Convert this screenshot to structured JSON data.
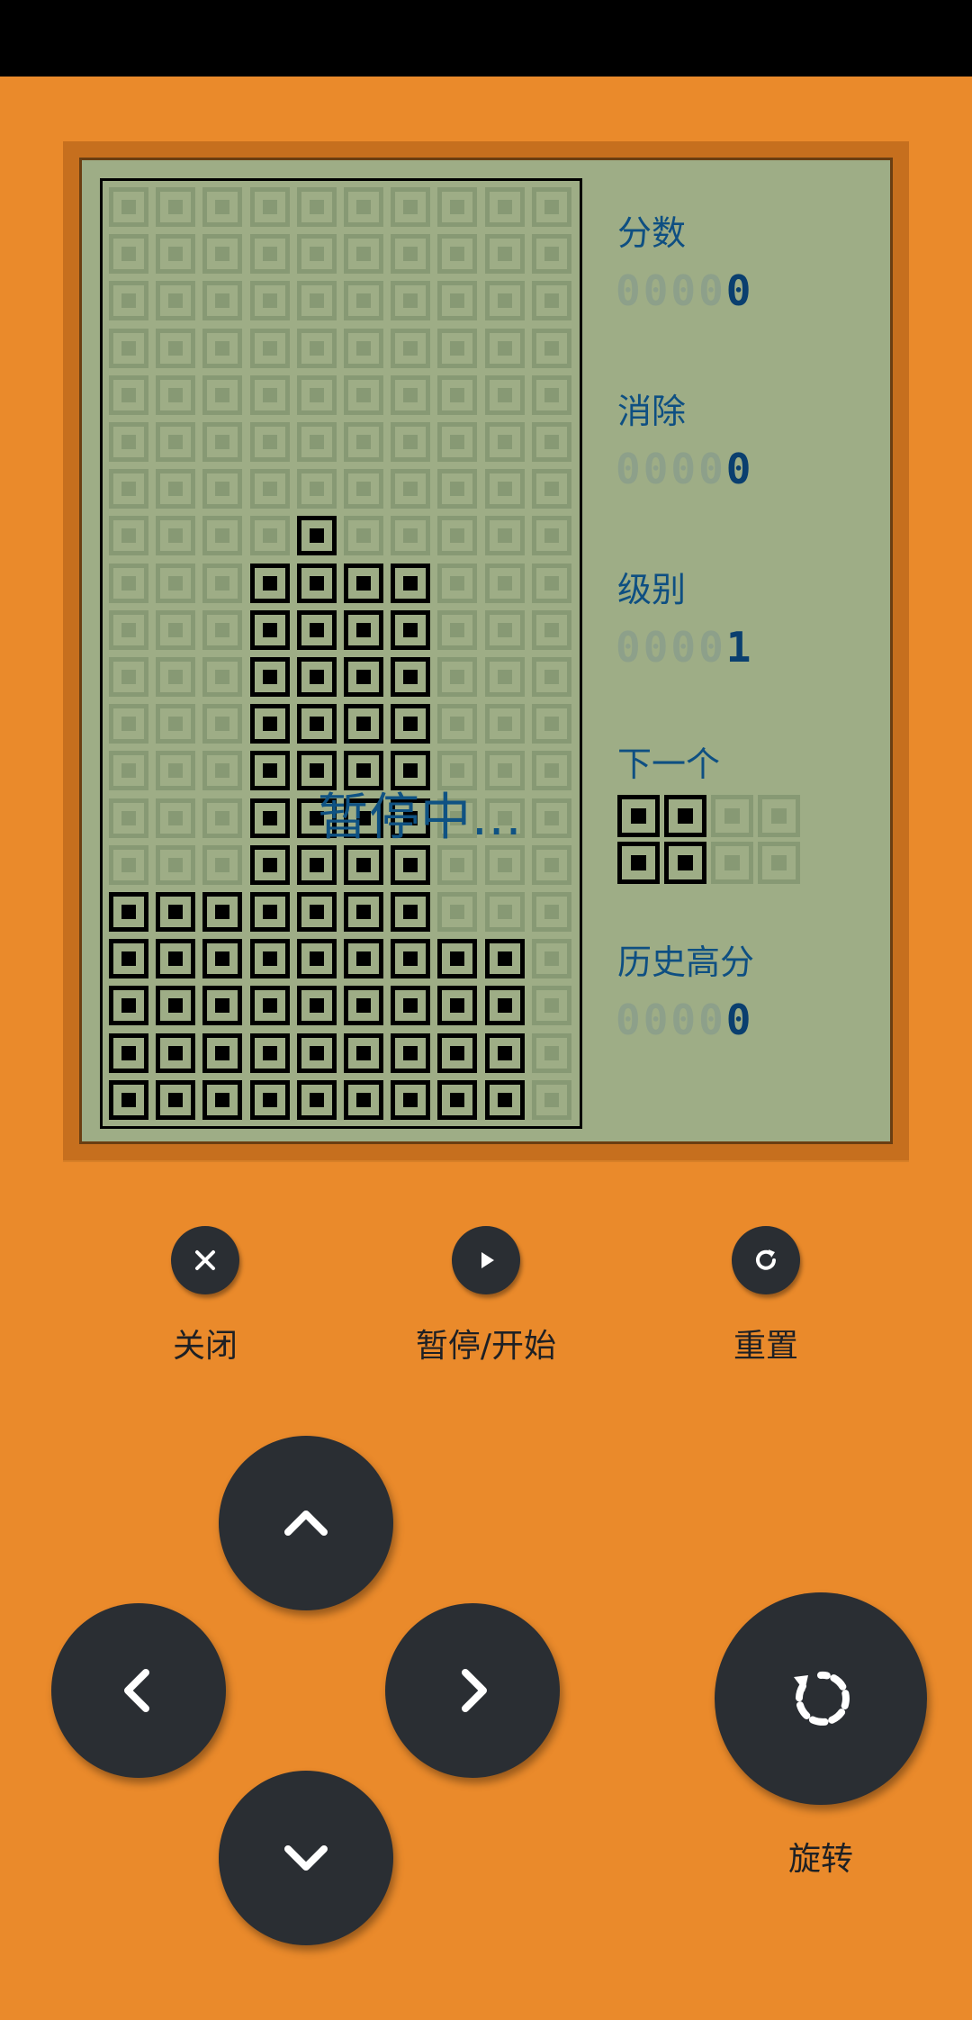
{
  "paused_text": "暂停中...",
  "score": {
    "label": "分数",
    "ghost": "0000",
    "value": "0"
  },
  "lines": {
    "label": "消除",
    "ghost": "0000",
    "value": "0"
  },
  "level": {
    "label": "级别",
    "ghost": "0000",
    "value": "1"
  },
  "next": {
    "label": "下一个",
    "piece": [
      [
        1,
        1,
        0,
        0
      ],
      [
        1,
        1,
        0,
        0
      ]
    ]
  },
  "high_score": {
    "label": "历史高分",
    "ghost": "0000",
    "value": "0"
  },
  "buttons": {
    "close": "关闭",
    "pause_start": "暂停/开始",
    "reset": "重置",
    "rotate": "旋转"
  },
  "icons": {
    "close": "close-icon",
    "pause_start": "play-icon",
    "reset": "refresh-icon",
    "up": "chevron-up-icon",
    "left": "chevron-left-icon",
    "right": "chevron-right-icon",
    "down": "chevron-down-icon",
    "rotate": "rotate-icon"
  },
  "colors": {
    "background": "#EA8A2B",
    "lcd": "#9EAD86",
    "block_on": "#000000",
    "block_off": "#879974",
    "text": "#0E4F82"
  },
  "board": {
    "cols": 10,
    "rows": 20,
    "grid": [
      "0000000000",
      "0000000000",
      "0000000000",
      "0000000000",
      "0000000000",
      "0000000000",
      "0000000000",
      "0000100000",
      "0001111000",
      "0001111000",
      "0001111000",
      "0001111000",
      "0001111000",
      "0001111000",
      "0001111000",
      "1111111000",
      "1111111110",
      "1111111110",
      "1111111110",
      "1111111110"
    ]
  }
}
